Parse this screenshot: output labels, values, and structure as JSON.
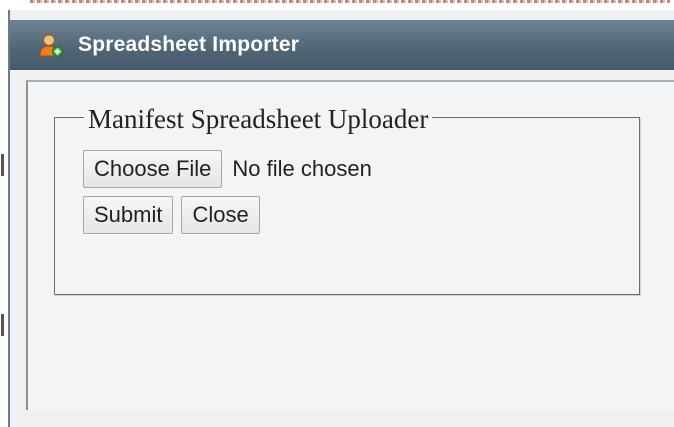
{
  "dialog": {
    "title": "Spreadsheet Importer",
    "icon": "user-add-icon"
  },
  "form": {
    "legend": "Manifest Spreadsheet Uploader",
    "choose_file_label": "Choose File",
    "file_status": "No file chosen",
    "submit_label": "Submit",
    "close_label": "Close"
  },
  "colors": {
    "titlebar": "#4f6576",
    "title_text": "#ffffff",
    "dialog_bg": "#eef0f2"
  }
}
